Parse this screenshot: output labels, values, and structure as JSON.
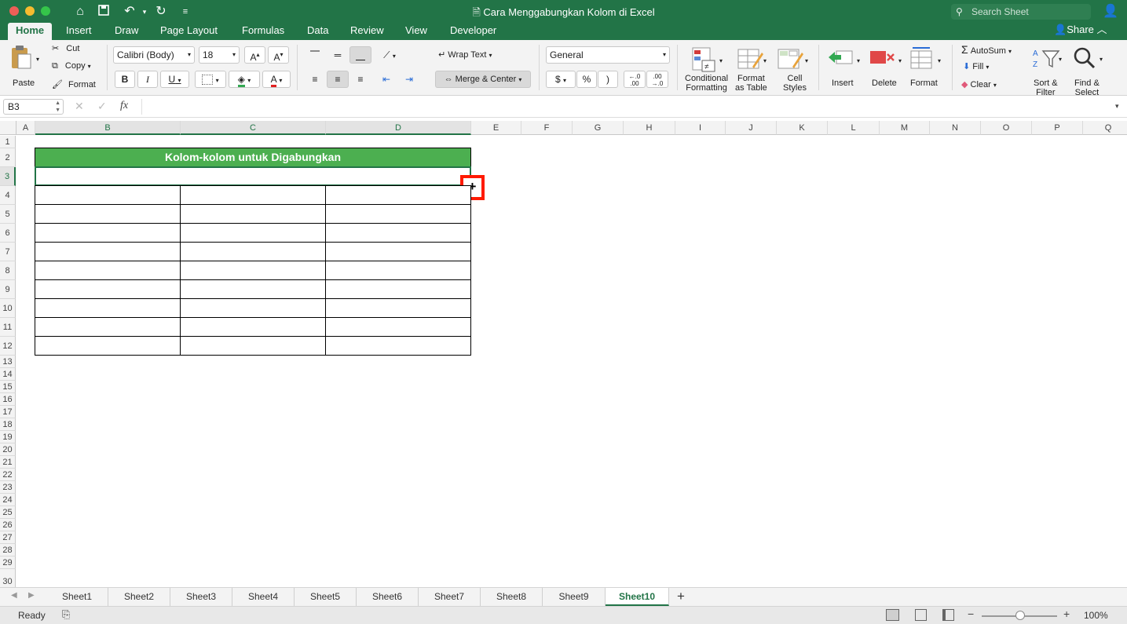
{
  "window": {
    "title": "Cara Menggabungkan Kolom di Excel",
    "search_placeholder": "Search Sheet"
  },
  "ribbon_tabs": [
    "Home",
    "Insert",
    "Draw",
    "Page Layout",
    "Formulas",
    "Data",
    "Review",
    "View",
    "Developer"
  ],
  "share_label": "Share",
  "clipboard": {
    "paste": "Paste",
    "cut": "Cut",
    "copy": "Copy",
    "format": "Format"
  },
  "font": {
    "name": "Calibri (Body)",
    "size": "18",
    "bold": "B",
    "italic": "I",
    "underline": "U",
    "font_color": "A"
  },
  "alignment": {
    "wrap_text": "Wrap Text",
    "merge_center": "Merge & Center"
  },
  "number": {
    "format": "General",
    "currency": "$",
    "percent": "%",
    "comma": ")",
    "inc_dec_1": "←.0\n.00",
    "dec_dec_1": ".00\n→.0"
  },
  "styles": {
    "conditional": "Conditional\nFormatting",
    "format_table": "Format\nas Table",
    "cell_styles": "Cell\nStyles"
  },
  "cells_group": {
    "insert": "Insert",
    "delete": "Delete",
    "format": "Format"
  },
  "editing": {
    "autosum": "AutoSum",
    "fill": "Fill",
    "clear": "Clear",
    "sort_filter": "Sort &\nFilter",
    "find_select": "Find &\nSelect"
  },
  "formula_bar": {
    "name_box": "B3",
    "fx": "fx",
    "value": ""
  },
  "columns": [
    "A",
    "B",
    "C",
    "D",
    "E",
    "F",
    "G",
    "H",
    "I",
    "J",
    "K",
    "L",
    "M",
    "N",
    "O",
    "P",
    "Q"
  ],
  "rows": [
    "1",
    "2",
    "3",
    "4",
    "5",
    "6",
    "7",
    "8",
    "9",
    "10",
    "11",
    "12",
    "13",
    "14",
    "15",
    "16",
    "17",
    "18",
    "19",
    "20",
    "21",
    "22",
    "23",
    "24",
    "25",
    "26",
    "27",
    "28",
    "29",
    "30"
  ],
  "table": {
    "header": "Kolom-kolom untuk Digabungkan",
    "header_color": "#4caf50"
  },
  "sheets": [
    "Sheet1",
    "Sheet2",
    "Sheet3",
    "Sheet4",
    "Sheet5",
    "Sheet6",
    "Sheet7",
    "Sheet8",
    "Sheet9",
    "Sheet10"
  ],
  "active_sheet": "Sheet10",
  "status": {
    "ready": "Ready",
    "zoom": "100%"
  },
  "colors": {
    "excel_green": "#227447",
    "highlight_red": "#ff1a00"
  }
}
